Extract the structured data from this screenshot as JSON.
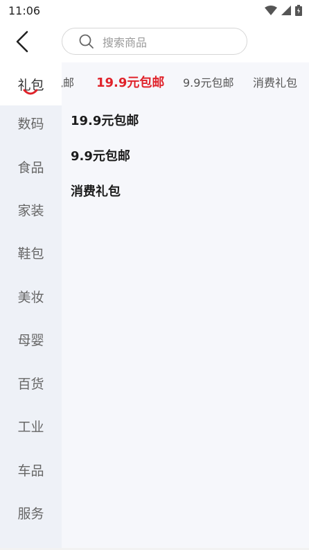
{
  "status_bar": {
    "time": "11:06"
  },
  "search": {
    "placeholder": "搜索商品"
  },
  "sidebar": {
    "items": [
      {
        "label": "礼包",
        "active": true
      },
      {
        "label": "数码"
      },
      {
        "label": "食品"
      },
      {
        "label": "家装"
      },
      {
        "label": "鞋包"
      },
      {
        "label": "美妆"
      },
      {
        "label": "母婴"
      },
      {
        "label": "百货"
      },
      {
        "label": "工业"
      },
      {
        "label": "车品"
      },
      {
        "label": "服务"
      }
    ]
  },
  "tabs": [
    {
      "label": "包邮"
    },
    {
      "label": "19.9元包邮",
      "active": true
    },
    {
      "label": "9.9元包邮"
    },
    {
      "label": "消费礼包"
    }
  ],
  "sub_items": [
    {
      "label": "19.9元包邮"
    },
    {
      "label": "9.9元包邮"
    },
    {
      "label": "消费礼包"
    }
  ],
  "colors": {
    "accent": "#e0222a",
    "sidebar_bg": "#eef1f7",
    "content_bg": "#f6f7fb"
  }
}
